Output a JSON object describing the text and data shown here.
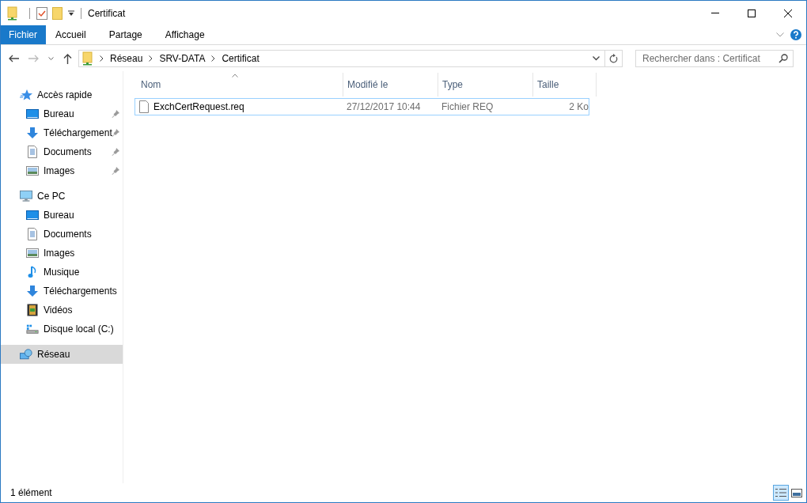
{
  "window": {
    "title": "Certificat"
  },
  "ribbon": {
    "tabs": [
      {
        "label": "Fichier",
        "selected": true
      },
      {
        "label": "Accueil",
        "selected": false
      },
      {
        "label": "Partage",
        "selected": false
      },
      {
        "label": "Affichage",
        "selected": false
      }
    ]
  },
  "address_bar": {
    "path": [
      "Réseau",
      "SRV-DATA",
      "Certificat"
    ],
    "search_placeholder": "Rechercher dans : Certificat"
  },
  "sidebar": {
    "sections": [
      {
        "label": "Accès rapide",
        "selected": false,
        "items": [
          {
            "label": "Bureau",
            "pinned": true
          },
          {
            "label": "Téléchargement",
            "pinned": true
          },
          {
            "label": "Documents",
            "pinned": true
          },
          {
            "label": "Images",
            "pinned": true
          }
        ]
      },
      {
        "label": "Ce PC",
        "selected": false,
        "items": [
          {
            "label": "Bureau",
            "pinned": false
          },
          {
            "label": "Documents",
            "pinned": false
          },
          {
            "label": "Images",
            "pinned": false
          },
          {
            "label": "Musique",
            "pinned": false
          },
          {
            "label": "Téléchargements",
            "pinned": false
          },
          {
            "label": "Vidéos",
            "pinned": false
          },
          {
            "label": "Disque local (C:)",
            "pinned": false
          }
        ]
      },
      {
        "label": "Réseau",
        "selected": true
      }
    ]
  },
  "table": {
    "columns": [
      "Nom",
      "Modifié le",
      "Type",
      "Taille"
    ],
    "rows": [
      {
        "name": "ExchCertRequest.req",
        "modified": "27/12/2017 10:44",
        "type": "Fichier REQ",
        "size": "2 Ko",
        "focused": true
      }
    ]
  },
  "status_bar": {
    "text": "1 élément"
  }
}
